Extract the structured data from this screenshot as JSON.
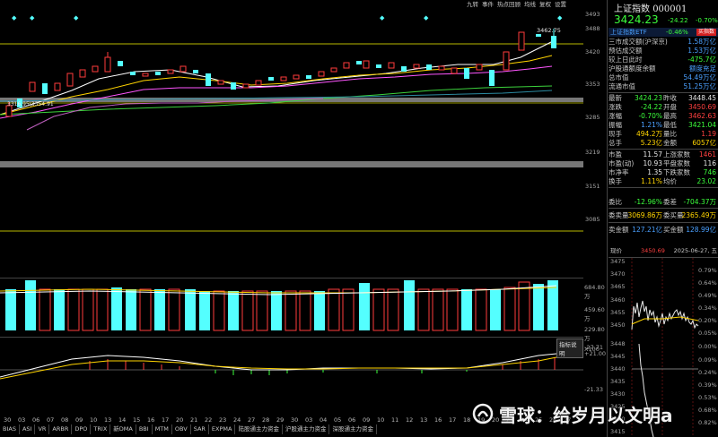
{
  "topbar": {
    "items": [
      "九转",
      "事件",
      "热点回顾",
      "均线",
      "复权",
      "设置"
    ],
    "ytop": "3493"
  },
  "quote": {
    "title": "上证指数",
    "code": "000001",
    "price": "3424.23",
    "change": "-24.22",
    "change_pct": "-0.70%",
    "etf_label": "上证指数ETF",
    "etf_change": "-0.46%",
    "buy_label": "买指数",
    "info_rows": [
      {
        "label": "三市成交额(沪深京)",
        "value": "1.58万亿"
      },
      {
        "label": "预估成交额",
        "value": "1.53万亿"
      },
      {
        "label": "较上日此时",
        "value": "-475.7亿"
      },
      {
        "label": "沪股通额度余额",
        "value": "额度充足"
      },
      {
        "label": "总市值",
        "value": "54.49万亿"
      },
      {
        "label": "流通市值",
        "value": "51.25万亿"
      }
    ],
    "grid_rows": [
      {
        "l1": "最新",
        "v1": "3424.23",
        "l2": "昨收",
        "v2": "3448.45"
      },
      {
        "l1": "涨跌",
        "v1": "-24.22",
        "l2": "开盘",
        "v2": "3450.69"
      },
      {
        "l1": "涨幅",
        "v1": "-0.70%",
        "l2": "最高",
        "v2": "3462.63"
      },
      {
        "l1": "振幅",
        "v1": "1.21%",
        "l2": "最低",
        "v2": "3421.04"
      },
      {
        "l1": "现手",
        "v1": "494.2万",
        "l2": "量比",
        "v2": "1.19"
      },
      {
        "l1": "总手",
        "v1": "5.23亿",
        "l2": "金额",
        "v2": "6057亿"
      },
      {
        "l1": "市盈",
        "v1": "11.57",
        "l2": "上涨家数",
        "v2": "1461"
      },
      {
        "l1": "市盈(动)",
        "v1": "10.93",
        "l2": "平盘家数",
        "v2": "116"
      },
      {
        "l1": "市净率",
        "v1": "1.35",
        "l2": "下跌家数",
        "v2": "746"
      },
      {
        "l1": "换手",
        "v1": "1.11%",
        "l2": "均价",
        "v2": "23.02"
      }
    ],
    "weibi": {
      "l1": "委比",
      "v1": "-12.96%",
      "l2": "委差",
      "v2": "-704.37万"
    },
    "weiliang": {
      "l1": "委卖量",
      "v1": "3069.86万",
      "l2": "委买量",
      "v2": "2365.49万"
    },
    "amount": {
      "l1": "卖金额",
      "v1": "127.21亿",
      "l2": "买金额",
      "v2": "128.99亿"
    }
  },
  "intraday": {
    "now_label": "现价",
    "now_value": "3450.69",
    "date": "2025-06-27, 五",
    "price_ticks": [
      "3475",
      "3470",
      "3465",
      "3460",
      "3455",
      "3450",
      "3448",
      "3445",
      "3440",
      "3435",
      "3430",
      "3425",
      "3420",
      "3415"
    ],
    "pct_ticks": [
      "0.79%",
      "0.64%",
      "0.49%",
      "0.34%",
      "0.20%",
      "0.05%",
      "0.00%",
      "0.09%",
      "0.24%",
      "0.39%",
      "0.53%",
      "0.68%",
      "0.82%"
    ]
  },
  "kchart": {
    "y_ticks": [
      "3488",
      "3420",
      "3353",
      "3285",
      "3219",
      "3151",
      "3085"
    ],
    "high_label": "3462.75",
    "low_label": "3316.95\\3354.91"
  },
  "volume": {
    "y_ticks": [
      "684.80万",
      "459.60万",
      "229.80万",
      "X100"
    ]
  },
  "macd": {
    "label": "指标说明",
    "y_ticks": [
      "-27.71",
      "+21.00",
      "-21.33"
    ]
  },
  "x_dates": [
    "30",
    "03",
    "06",
    "07",
    "08",
    "09",
    "10",
    "13",
    "14",
    "15",
    "16",
    "17",
    "20",
    "21",
    "22",
    "23",
    "24",
    "27",
    "28",
    "29",
    "30",
    "03",
    "04",
    "05",
    "06",
    "09",
    "10",
    "11",
    "12",
    "13",
    "16",
    "17",
    "18",
    "19",
    "20",
    "23",
    "24",
    "25",
    "26",
    "27"
  ],
  "tabs": [
    "BIAS",
    "ASI",
    "VR",
    "ARBR",
    "DPO",
    "TRIX",
    "新DMA",
    "BBI",
    "MTM",
    "OBV",
    "SAR",
    "EXPMA",
    "陆股通主力资金",
    "沪股通主力资金",
    "深股通主力资金"
  ],
  "watermark": "雪球：给岁月以文明a"
}
